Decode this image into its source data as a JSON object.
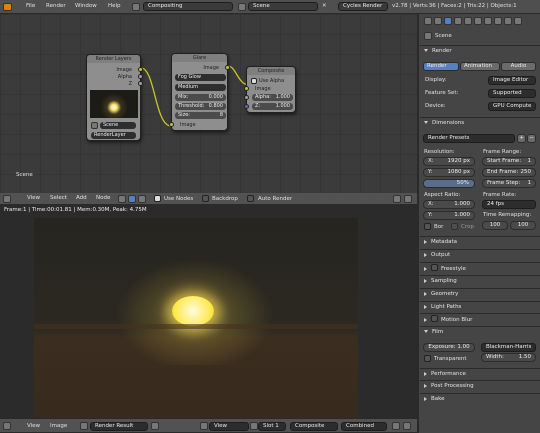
{
  "topbar": {
    "menus": [
      "File",
      "Render",
      "Window",
      "Help"
    ],
    "screen_layout": "Compositing",
    "scene": "Scene",
    "engine": "Cycles Render",
    "stats": "v2.78 | Verts:36 | Faces:2 | Tris:22 | Objects:1"
  },
  "node_editor": {
    "scene_label": "Scene",
    "render_layers_node": {
      "title": "Render Layers",
      "outputs": [
        "Image",
        "Alpha",
        "Z"
      ],
      "scene_select": "Scene",
      "layer_select": "RenderLayer"
    },
    "glare_node": {
      "title": "Glare",
      "output": "Image",
      "type": "Fog Glow",
      "quality": "Medium",
      "mix": "Mix:",
      "mix_value": "0.000",
      "threshold": "Threshold:",
      "threshold_value": "0.800",
      "size": "Size:",
      "size_value": "8",
      "input": "Image"
    },
    "composite_node": {
      "title": "Composite",
      "use_alpha": "Use Alpha",
      "input_image": "Image",
      "alpha": "Alpha:",
      "alpha_value": "1.000",
      "z": "Z:",
      "z_value": "1.000"
    },
    "header": {
      "menus": [
        "View",
        "Select",
        "Add",
        "Node"
      ],
      "use_nodes": "Use Nodes",
      "backdrop": "Backdrop",
      "auto_render": "Auto Render"
    }
  },
  "image_editor": {
    "info": "Frame:1 | Time:00:01.81 | Mem:0.30M, Peak: 4.75M",
    "header": {
      "menus": [
        "View",
        "Image"
      ],
      "image_name": "Render Result",
      "view": "View",
      "slot": "Slot 1",
      "pass": "Composite",
      "combined": "Combined"
    }
  },
  "properties": {
    "context": "Scene",
    "render_panel": {
      "title": "Render",
      "render_btn": "Render",
      "animation_btn": "Animation",
      "audio_btn": "Audio",
      "display_label": "Display:",
      "display_value": "Image Editor",
      "feature_label": "Feature Set:",
      "feature_value": "Supported",
      "device_label": "Device:",
      "device_value": "GPU Compute"
    },
    "dimensions_panel": {
      "title": "Dimensions",
      "presets": "Render Presets",
      "resolution_label": "Resolution:",
      "res_x": "X:",
      "res_x_val": "1920 px",
      "res_y": "Y:",
      "res_y_val": "1080 px",
      "res_pct": "50%",
      "frame_range_label": "Frame Range:",
      "start_frame": "Start Frame:",
      "start_frame_val": "1",
      "end_frame": "End Frame:",
      "end_frame_val": "250",
      "frame_step": "Frame Step:",
      "frame_step_val": "1",
      "aspect_label": "Aspect Ratio:",
      "asp_x": "X:",
      "asp_x_val": "1.000",
      "asp_y": "Y:",
      "asp_y_val": "1.000",
      "frame_rate_label": "Frame Rate:",
      "frame_rate_val": "24 fps",
      "time_remap_label": "Time Remapping:",
      "remap_old": "100",
      "remap_new": "100",
      "border": "Bor",
      "crop": "Crop"
    },
    "collapsed_panels": [
      "Metadata",
      "Output",
      "Freestyle",
      "Sampling",
      "Geometry",
      "Light Paths",
      "Motion Blur"
    ],
    "film_panel": {
      "title": "Film",
      "exposure": "Exposure: 1.00",
      "filter": "Blackman-Harris",
      "transparent": "Transparent",
      "width": "Width:",
      "width_val": "1.50"
    },
    "bottom_panels": [
      "Performance",
      "Post Processing",
      "Bake"
    ]
  }
}
